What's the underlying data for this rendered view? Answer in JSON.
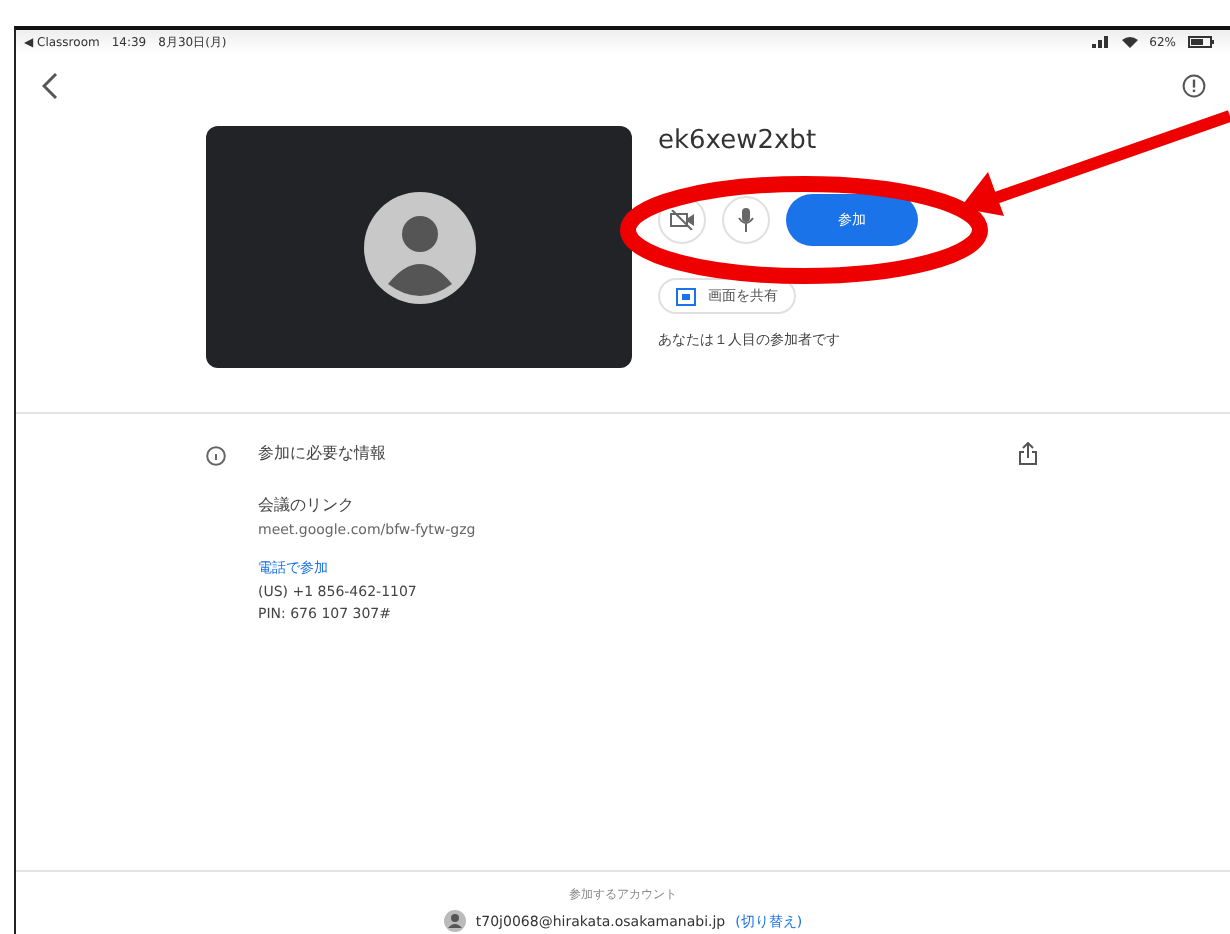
{
  "status_bar": {
    "back_app": "◀ Classroom",
    "time": "14:39",
    "date": "8月30日(月)",
    "battery": "62%"
  },
  "meeting": {
    "code": "ek6xew2xbt",
    "camera_on": false,
    "join_button": "参加",
    "present_button": "画面を共有",
    "participants_note": "あなたは１人目の参加者です"
  },
  "info": {
    "heading": "参加に必要な情報",
    "link_label": "会議のリンク",
    "link": "meet.google.com/bfw-fytw-gzg",
    "phone_link": "電話で参加",
    "phone": "(US) +1 856-462-1107",
    "pin": "PIN: 676 107 307#"
  },
  "account": {
    "label": "参加するアカウント",
    "email": "t70j0068@hirakata.osakamanabi.jp",
    "switch_link": "(切り替え)"
  }
}
